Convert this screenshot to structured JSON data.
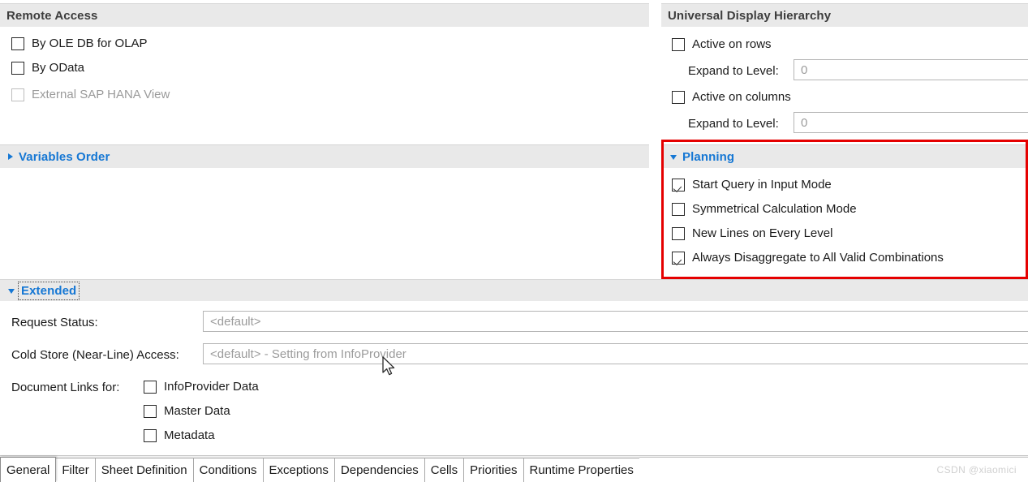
{
  "panels": {
    "remote_access": {
      "title": "Remote Access",
      "checkboxes": [
        {
          "label": "By OLE DB for OLAP",
          "checked": false,
          "disabled": false
        },
        {
          "label": "By OData",
          "checked": false,
          "disabled": false
        },
        {
          "label": "External SAP HANA View",
          "checked": false,
          "disabled": true
        }
      ]
    },
    "variables_order": {
      "title": "Variables Order",
      "expanded": false,
      "arrow_icon": "chevron-right-icon"
    },
    "universal_display_hierarchy": {
      "title": "Universal Display Hierarchy",
      "active_on_rows": {
        "label": "Active on rows",
        "checked": false
      },
      "expand_rows": {
        "label": "Expand to Level:",
        "value": "0"
      },
      "active_on_columns": {
        "label": "Active on columns",
        "checked": false
      },
      "expand_columns": {
        "label": "Expand to Level:",
        "value": "0"
      }
    },
    "planning": {
      "title": "Planning",
      "expanded": true,
      "arrow_icon": "chevron-down-icon",
      "highlight_color": "#e50000",
      "checkboxes": [
        {
          "label": "Start Query in Input Mode",
          "checked": true
        },
        {
          "label": "Symmetrical Calculation Mode",
          "checked": false
        },
        {
          "label": "New Lines on Every Level",
          "checked": false
        },
        {
          "label": "Always Disaggregate to All Valid Combinations",
          "checked": true
        }
      ]
    },
    "extended": {
      "title": "Extended",
      "expanded": true,
      "arrow_icon": "chevron-down-icon",
      "fields": [
        {
          "label": "Request Status:",
          "value": "<default>"
        },
        {
          "label": "Cold Store (Near-Line) Access:",
          "value": "<default> - Setting from InfoProvider"
        }
      ],
      "document_links": {
        "label": "Document Links for:",
        "checkboxes": [
          {
            "label": "InfoProvider Data",
            "checked": false
          },
          {
            "label": "Master Data",
            "checked": false
          },
          {
            "label": "Metadata",
            "checked": false
          }
        ]
      }
    }
  },
  "tabs": [
    {
      "label": "General",
      "active": true
    },
    {
      "label": "Filter",
      "active": false
    },
    {
      "label": "Sheet Definition",
      "active": false
    },
    {
      "label": "Conditions",
      "active": false
    },
    {
      "label": "Exceptions",
      "active": false
    },
    {
      "label": "Dependencies",
      "active": false
    },
    {
      "label": "Cells",
      "active": false
    },
    {
      "label": "Priorities",
      "active": false
    },
    {
      "label": "Runtime Properties",
      "active": false
    }
  ],
  "watermark": "CSDN @xiaomici",
  "colors": {
    "accent_link": "#1577d4",
    "band_bg": "#e9e9e9",
    "highlight": "#e50000"
  }
}
